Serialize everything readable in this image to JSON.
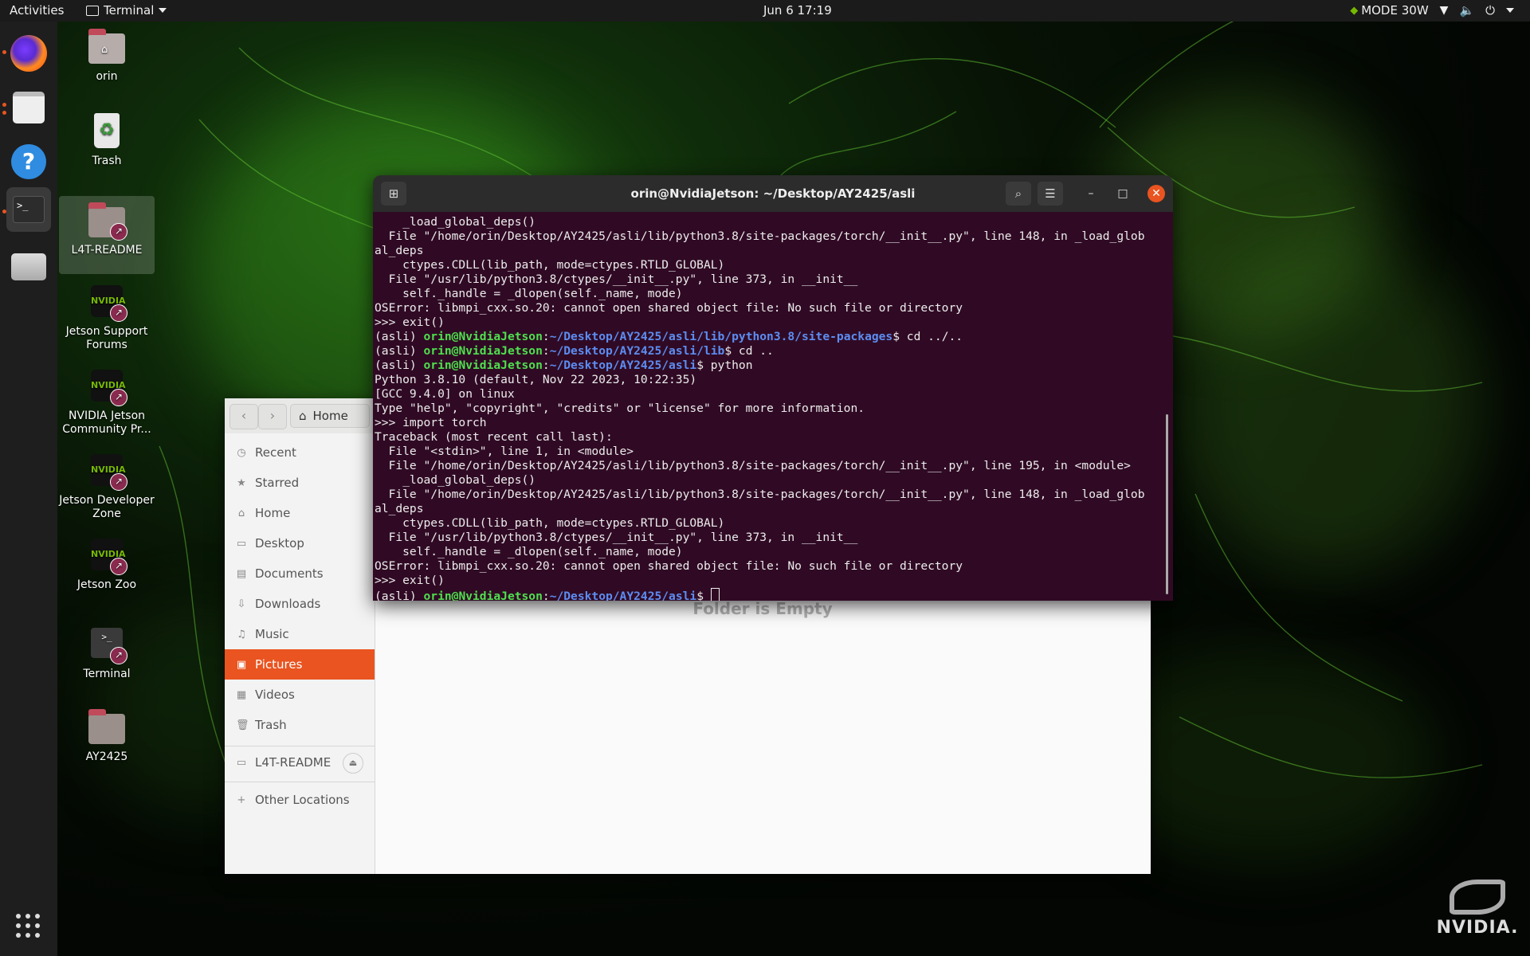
{
  "topbar": {
    "activities": "Activities",
    "app_menu": "Terminal",
    "clock": "Jun 6  17:19",
    "mode": "MODE 30W",
    "tray_icons": [
      "wifi-icon",
      "volume-icon",
      "power-icon"
    ]
  },
  "dock": {
    "items": [
      "firefox",
      "files",
      "help",
      "terminal",
      "drive"
    ],
    "apps_grid": "show-applications"
  },
  "desktop_icons": [
    {
      "label": "orin"
    },
    {
      "label": "Trash"
    },
    {
      "label": "L4T-README"
    },
    {
      "label": "Jetson Support Forums"
    },
    {
      "label": "NVIDIA Jetson Community Pr..."
    },
    {
      "label": "Jetson Developer Zone"
    },
    {
      "label": "Jetson Zoo"
    },
    {
      "label": "Terminal"
    },
    {
      "label": "AY2425"
    }
  ],
  "files": {
    "path_label": "Home",
    "sidebar": [
      {
        "label": "Recent",
        "icon": "clock-icon"
      },
      {
        "label": "Starred",
        "icon": "star-icon"
      },
      {
        "label": "Home",
        "icon": "home-icon"
      },
      {
        "label": "Desktop",
        "icon": "desktop-icon"
      },
      {
        "label": "Documents",
        "icon": "document-icon"
      },
      {
        "label": "Downloads",
        "icon": "download-icon"
      },
      {
        "label": "Music",
        "icon": "music-icon"
      },
      {
        "label": "Pictures",
        "icon": "picture-icon",
        "selected": true
      },
      {
        "label": "Videos",
        "icon": "video-icon"
      },
      {
        "label": "Trash",
        "icon": "trash-icon"
      },
      {
        "label": "L4T-README",
        "icon": "drive-icon"
      },
      {
        "label": "Other Locations",
        "icon": "plus-icon"
      }
    ],
    "empty_text": "Folder is Empty"
  },
  "terminal": {
    "title": "orin@NvidiaJetson: ~/Desktop/AY2425/asli",
    "lines": [
      [
        {
          "t": "    _load_global_deps()"
        }
      ],
      [
        {
          "t": "  File \"/home/orin/Desktop/AY2425/asli/lib/python3.8/site-packages/torch/__init__.py\", line 148, in _load_glob"
        }
      ],
      [
        {
          "t": "al_deps"
        }
      ],
      [
        {
          "t": "    ctypes.CDLL(lib_path, mode=ctypes.RTLD_GLOBAL)"
        }
      ],
      [
        {
          "t": "  File \"/usr/lib/python3.8/ctypes/__init__.py\", line 373, in __init__"
        }
      ],
      [
        {
          "t": "    self._handle = _dlopen(self._name, mode)"
        }
      ],
      [
        {
          "t": "OSError: libmpi_cxx.so.20: cannot open shared object file: No such file or directory"
        }
      ],
      [
        {
          "t": ">>> exit()"
        }
      ],
      [
        {
          "t": "(asli) "
        },
        {
          "t": "orin@NvidiaJetson",
          "c": "g"
        },
        {
          "t": ":"
        },
        {
          "t": "~/Desktop/AY2425/asli/lib/python3.8/site-packages",
          "c": "b"
        },
        {
          "t": "$ cd ../.."
        }
      ],
      [
        {
          "t": "(asli) "
        },
        {
          "t": "orin@NvidiaJetson",
          "c": "g"
        },
        {
          "t": ":"
        },
        {
          "t": "~/Desktop/AY2425/asli/lib",
          "c": "b"
        },
        {
          "t": "$ cd .."
        }
      ],
      [
        {
          "t": "(asli) "
        },
        {
          "t": "orin@NvidiaJetson",
          "c": "g"
        },
        {
          "t": ":"
        },
        {
          "t": "~/Desktop/AY2425/asli",
          "c": "b"
        },
        {
          "t": "$ python"
        }
      ],
      [
        {
          "t": "Python 3.8.10 (default, Nov 22 2023, 10:22:35)"
        }
      ],
      [
        {
          "t": "[GCC 9.4.0] on linux"
        }
      ],
      [
        {
          "t": "Type \"help\", \"copyright\", \"credits\" or \"license\" for more information."
        }
      ],
      [
        {
          "t": ">>> import torch"
        }
      ],
      [
        {
          "t": "Traceback (most recent call last):"
        }
      ],
      [
        {
          "t": "  File \"<stdin>\", line 1, in <module>"
        }
      ],
      [
        {
          "t": "  File \"/home/orin/Desktop/AY2425/asli/lib/python3.8/site-packages/torch/__init__.py\", line 195, in <module>"
        }
      ],
      [
        {
          "t": "    _load_global_deps()"
        }
      ],
      [
        {
          "t": "  File \"/home/orin/Desktop/AY2425/asli/lib/python3.8/site-packages/torch/__init__.py\", line 148, in _load_glob"
        }
      ],
      [
        {
          "t": "al_deps"
        }
      ],
      [
        {
          "t": "    ctypes.CDLL(lib_path, mode=ctypes.RTLD_GLOBAL)"
        }
      ],
      [
        {
          "t": "  File \"/usr/lib/python3.8/ctypes/__init__.py\", line 373, in __init__"
        }
      ],
      [
        {
          "t": "    self._handle = _dlopen(self._name, mode)"
        }
      ],
      [
        {
          "t": "OSError: libmpi_cxx.so.20: cannot open shared object file: No such file or directory"
        }
      ],
      [
        {
          "t": ">>> exit()"
        }
      ],
      [
        {
          "t": "(asli) "
        },
        {
          "t": "orin@NvidiaJetson",
          "c": "g"
        },
        {
          "t": ":"
        },
        {
          "t": "~/Desktop/AY2425/asli",
          "c": "b"
        },
        {
          "t": "$ "
        }
      ]
    ]
  },
  "nvidia_logo_text": "NVIDIA.",
  "colors": {
    "accent": "#e95420",
    "terminal_bg": "#300a24",
    "prompt_user": "#4ee04e",
    "prompt_path": "#5c8df2"
  }
}
